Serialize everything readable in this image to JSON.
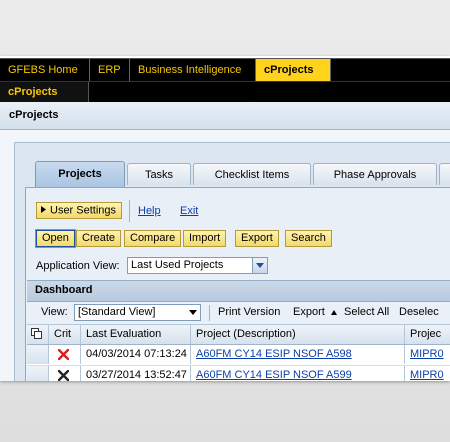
{
  "nav": {
    "tabs": [
      {
        "label": "GFEBS Home"
      },
      {
        "label": "ERP"
      },
      {
        "label": "Business Intelligence"
      },
      {
        "label": "cProjects"
      }
    ],
    "subnav_label": "cProjects"
  },
  "app": {
    "title": "cProjects"
  },
  "tabs": [
    {
      "label": "Projects"
    },
    {
      "label": "Tasks"
    },
    {
      "label": "Checklist Items"
    },
    {
      "label": "Phase Approvals"
    }
  ],
  "toolbar": {
    "user_settings": "User Settings",
    "help": "Help",
    "exit": "Exit",
    "buttons": [
      "Open",
      "Create",
      "Compare",
      "Import",
      "Export",
      "Search"
    ]
  },
  "application_view": {
    "label": "Application View:",
    "value": "Last Used Projects"
  },
  "dashboard": {
    "title": "Dashboard",
    "view_label": "View:",
    "view_value": "[Standard View]",
    "print_version": "Print Version",
    "export": "Export",
    "select_all": "Select All",
    "deselect": "Deselec"
  },
  "grid": {
    "headers": [
      "Crit",
      "Last Evaluation",
      "Project (Description)",
      "Projec"
    ],
    "rows": [
      {
        "last_evaluation": "04/03/2014 07:13:24",
        "project": "A60FM CY14 ESIP NSOF A598",
        "project_id": "MIPR0"
      },
      {
        "last_evaluation": "03/27/2014 13:52:47",
        "project": "A60FM CY14 ESIP NSOF A599",
        "project_id": "MIPR0"
      }
    ]
  },
  "colors": {
    "nav_bg": "#000000",
    "nav_text": "#f7c700",
    "nav_active": "#ffd21c",
    "button_yellow": "#f3d96a",
    "panel_blue": "#dbe6f1",
    "crit_red": "#d42020"
  }
}
